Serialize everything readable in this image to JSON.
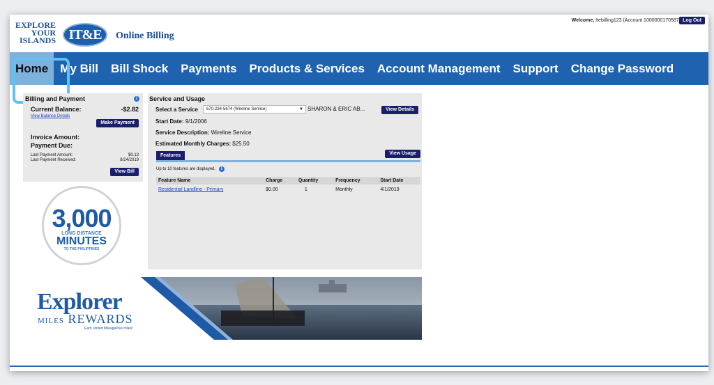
{
  "header": {
    "logo_text": "EXPLORE YOUR ISLANDS",
    "logo_mark": "IT&E",
    "brand_title": "Online Billing",
    "welcome_prefix": "Welcome,",
    "welcome_user": "Itebilling123 (Account 1000000170587)",
    "logout_label": "Log Out"
  },
  "nav": {
    "items": [
      {
        "label": "Home"
      },
      {
        "label": "My Bill"
      },
      {
        "label": "Bill Shock"
      },
      {
        "label": "Payments"
      },
      {
        "label": "Products & Services"
      },
      {
        "label": "Account Management"
      },
      {
        "label": "Support"
      },
      {
        "label": "Change Password"
      }
    ]
  },
  "billing": {
    "title": "Billing and Payment",
    "current_balance_label": "Current Balance:",
    "current_balance": "-$2.82",
    "view_balance_details": "View Balance Details",
    "make_payment": "Make Payment",
    "invoice_amount_label": "Invoice Amount:",
    "payment_due_label": "Payment Due:",
    "last_payment_amount_label": "Last Payment Amount:",
    "last_payment_amount": "$0.13",
    "last_payment_received_label": "Last Payment Received:",
    "last_payment_received": "8/24/2019",
    "view_bill": "View Bill"
  },
  "promo_badge": {
    "number": "3,000",
    "line1": "LONG DISTANCE",
    "line2": "MINUTES",
    "line3": "TO THE PHILIPPINES"
  },
  "service": {
    "title": "Service and Usage",
    "select_label": "Select a Service",
    "selected_service": "670-234-5674 (Wireline Service)",
    "account_holder": "SHARON & ERIC AB...",
    "view_details": "View Details",
    "start_date_label": "Start Date:",
    "start_date": "9/1/2006",
    "description_label": "Service Description:",
    "description": "Wireline Service",
    "monthly_label": "Estimated Monthly Charges:",
    "monthly": "$25.50",
    "view_usage": "View Usage",
    "features_tab": "Features",
    "features_note": "Up to 10 features are displayed.",
    "table": {
      "headers": [
        "Feature Name",
        "Charge",
        "Quantity",
        "Frequency",
        "Start Date"
      ],
      "rows": [
        [
          "Residential Landline - Primary",
          "$0.00",
          "1",
          "Monthly",
          "4/1/2019"
        ]
      ]
    }
  },
  "rewards": {
    "title": "Explorer",
    "sub_miles": "MILES",
    "sub_rewards": "REWARDS",
    "note": "Earn United MileagePlus miles!"
  },
  "colors": {
    "nav_blue": "#1f63b0",
    "active_tab": "#7fb1dd",
    "button_navy": "#1a1f6b",
    "focus_ring": "#5ec3f3"
  }
}
